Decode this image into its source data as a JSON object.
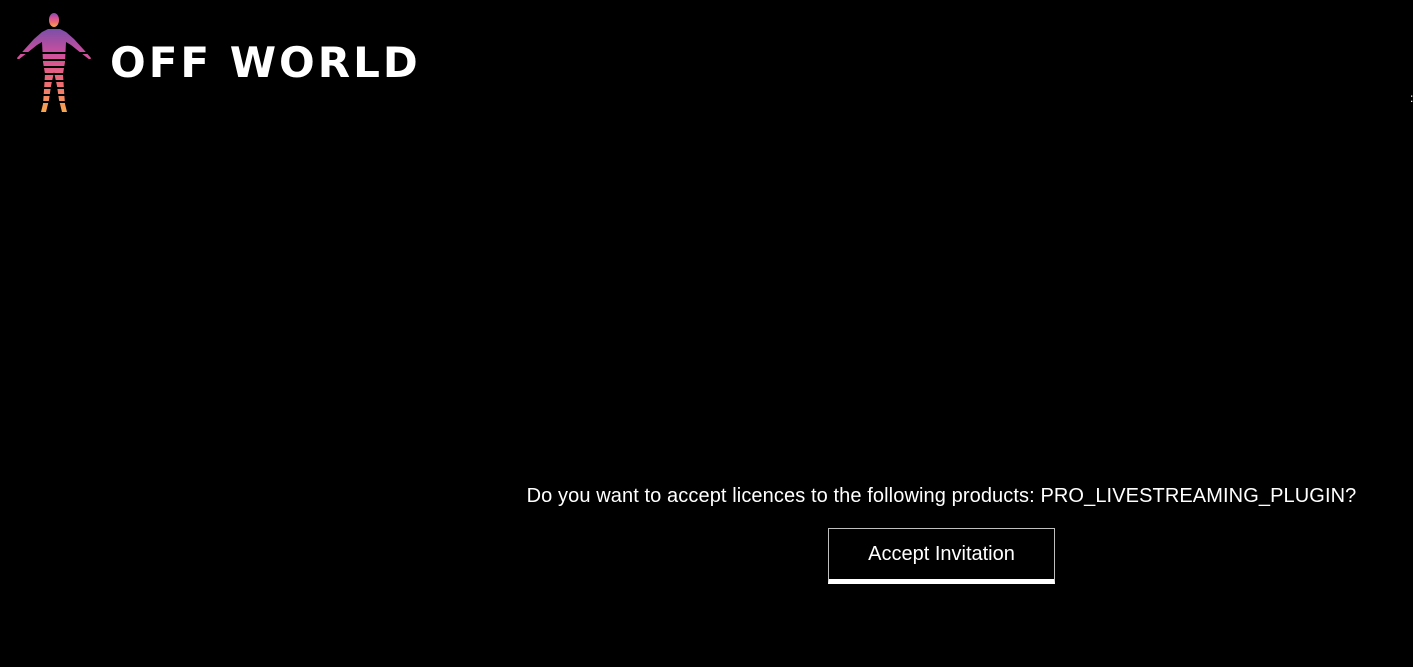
{
  "brand": {
    "name": "OFF WORLD",
    "logo_icon": "human-figure-logo-icon",
    "logo_gradient": [
      "#a855b5",
      "#e5537a",
      "#f7a14f"
    ]
  },
  "edge_glyph": ":",
  "invitation": {
    "question": "Do you want to accept licences to the following products: PRO_LIVESTREAMING_PLUGIN?",
    "accept_label": "Accept Invitation"
  },
  "colors": {
    "background": "#000000",
    "text": "#ffffff"
  }
}
